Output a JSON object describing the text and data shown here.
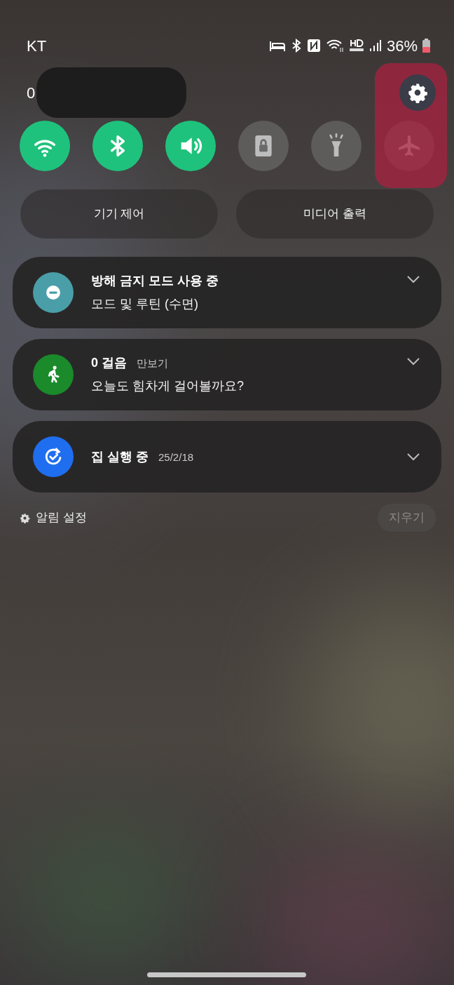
{
  "status_bar": {
    "carrier": "KT",
    "battery": "36%"
  },
  "header": {
    "text": "0"
  },
  "quick_tiles": [
    {
      "kind": "wifi",
      "on": true
    },
    {
      "kind": "bluetooth",
      "on": true
    },
    {
      "kind": "sound",
      "on": true
    },
    {
      "kind": "lock",
      "on": false
    },
    {
      "kind": "flashlight",
      "on": false
    },
    {
      "kind": "airplane",
      "on": false
    }
  ],
  "buttons": [
    "기기 제어",
    "미디어 출력"
  ],
  "notifications": [
    {
      "kind": "dnd",
      "color": "#4a9ea8",
      "title": "방해 금지 모드 사용 중",
      "text": "모드 및 루틴 (수면)"
    },
    {
      "kind": "walk",
      "color": "#1a8a2a",
      "title": "0 걸음",
      "app": "만보기",
      "text": "오늘도 힘차게 걸어볼까요?"
    },
    {
      "kind": "routine",
      "color": "#1f6ef0",
      "title": "집 실행 중",
      "app": "25/2/18"
    }
  ],
  "footer": {
    "settings": "알림 설정",
    "clear": "지우기",
    "clear_disabled": true
  }
}
